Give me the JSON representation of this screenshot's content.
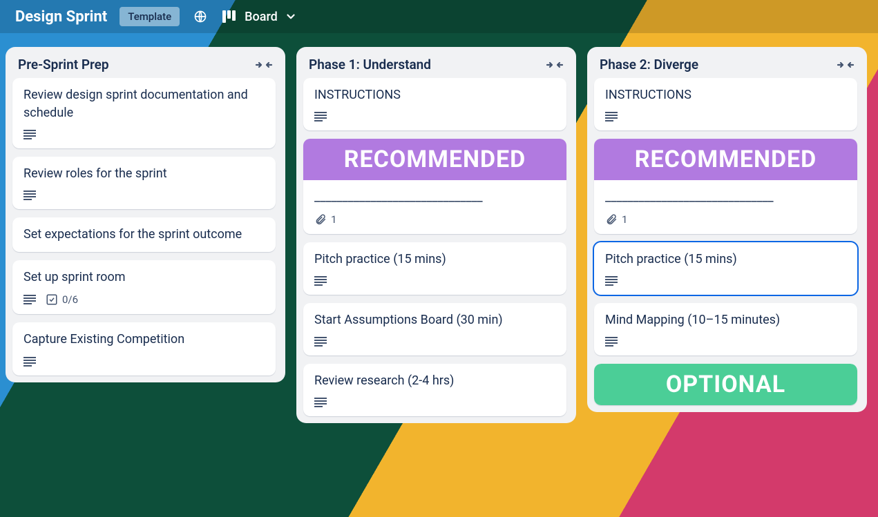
{
  "header": {
    "title": "Design Sprint",
    "template_label": "Template",
    "view_label": "Board"
  },
  "lists": [
    {
      "title": "Pre-Sprint Prep",
      "cards": [
        {
          "title": "Review design sprint documentation and schedule",
          "desc": true
        },
        {
          "title": "Review roles for the sprint",
          "desc": true
        },
        {
          "title": "Set expectations for the sprint outcome"
        },
        {
          "title": "Set up sprint room",
          "desc": true,
          "checklist": "0/6"
        },
        {
          "title": "Capture Existing Competition",
          "desc": true
        }
      ]
    },
    {
      "title": "Phase 1: Understand",
      "cards": [
        {
          "title": "INSTRUCTIONS",
          "desc": true
        },
        {
          "cover": "purple",
          "cover_text": "RECOMMENDED",
          "title": "______________________________",
          "attachments": "1"
        },
        {
          "title": "Pitch practice (15 mins)",
          "desc": true
        },
        {
          "title": "Start Assumptions Board (30 min)",
          "desc": true
        },
        {
          "title": "Review research (2-4 hrs)",
          "desc": true
        }
      ]
    },
    {
      "title": "Phase 2: Diverge",
      "cards": [
        {
          "title": "INSTRUCTIONS",
          "desc": true
        },
        {
          "cover": "purple",
          "cover_text": "RECOMMENDED",
          "title": "______________________________",
          "attachments": "1"
        },
        {
          "title": "Pitch practice (15 mins)",
          "desc": true,
          "selected": true
        },
        {
          "title": "Mind Mapping (10–15 minutes)",
          "desc": true
        },
        {
          "cover": "green",
          "cover_text": "OPTIONAL",
          "cover_only": true
        }
      ]
    }
  ]
}
